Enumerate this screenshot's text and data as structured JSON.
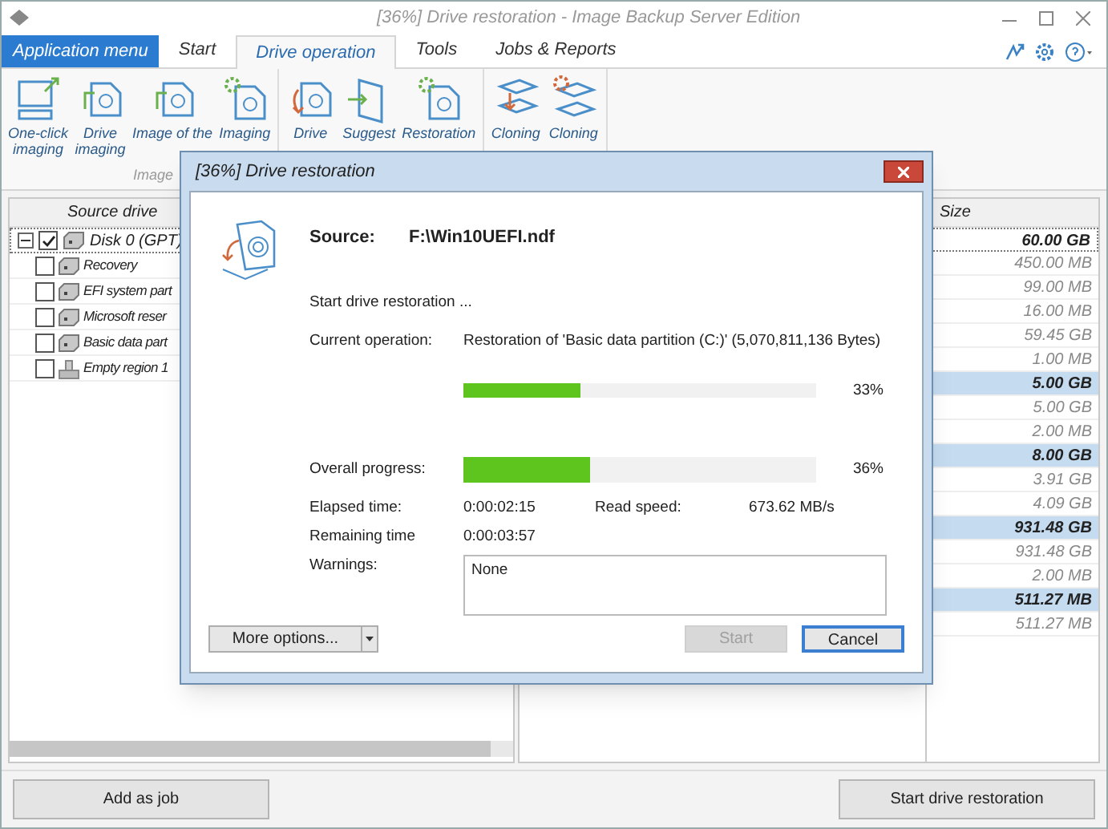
{
  "window": {
    "title": "[36%] Drive restoration - Image Backup Server Edition"
  },
  "app_menu": "Application menu",
  "tabs": [
    {
      "label": "Start",
      "selected": false
    },
    {
      "label": "Drive operation",
      "selected": true
    },
    {
      "label": "Tools",
      "selected": false
    },
    {
      "label": "Jobs & Reports",
      "selected": false
    }
  ],
  "ribbon": {
    "groups": [
      {
        "label": "Image",
        "items": [
          {
            "lines": [
              "One-click",
              "imaging"
            ],
            "kind": "monitor"
          },
          {
            "lines": [
              "Drive",
              "imaging"
            ],
            "kind": "disk"
          },
          {
            "lines": [
              "Image of the"
            ],
            "kind": "disk"
          },
          {
            "lines": [
              "Imaging"
            ],
            "kind": "gear"
          }
        ]
      },
      {
        "items": [
          {
            "lines": [
              "Drive"
            ],
            "kind": "restore"
          },
          {
            "lines": [
              "Suggest"
            ],
            "kind": "door"
          },
          {
            "lines": [
              "Restoration"
            ],
            "kind": "gear"
          }
        ]
      },
      {
        "items": [
          {
            "lines": [
              "Cloning"
            ],
            "kind": "clone"
          },
          {
            "lines": [
              "Cloning"
            ],
            "kind": "clonegear"
          }
        ]
      }
    ]
  },
  "source_tree": {
    "column": "Source drive",
    "disk": {
      "name": "Disk 0 (GPT)",
      "checked": true,
      "expanded": true,
      "children": [
        {
          "name": "Recovery",
          "checked": false,
          "kind": "partition"
        },
        {
          "name": "EFI system part",
          "checked": false,
          "kind": "partition"
        },
        {
          "name": "Microsoft reser",
          "checked": false,
          "kind": "partition"
        },
        {
          "name": "Basic data part",
          "checked": false,
          "kind": "partition"
        },
        {
          "name": "Empty region 1",
          "checked": false,
          "kind": "empty"
        }
      ]
    }
  },
  "size_table": {
    "column": "Size",
    "rows": [
      {
        "value": "60.00 GB",
        "kind": "disk",
        "focused": true
      },
      {
        "value": "450.00 MB",
        "kind": "partition",
        "focused": false
      },
      {
        "value": "99.00 MB",
        "kind": "partition",
        "focused": false
      },
      {
        "value": "16.00 MB",
        "kind": "partition",
        "focused": false
      },
      {
        "value": "59.45 GB",
        "kind": "partition",
        "focused": false
      },
      {
        "value": "1.00 MB",
        "kind": "partition",
        "focused": false
      },
      {
        "value": "5.00 GB",
        "kind": "disk",
        "focused": false
      },
      {
        "value": "5.00 GB",
        "kind": "partition",
        "focused": false
      },
      {
        "value": "2.00 MB",
        "kind": "partition",
        "focused": false
      },
      {
        "value": "8.00 GB",
        "kind": "disk",
        "focused": false
      },
      {
        "value": "3.91 GB",
        "kind": "partition",
        "focused": false
      },
      {
        "value": "4.09 GB",
        "kind": "partition",
        "focused": false
      },
      {
        "value": "931.48 GB",
        "kind": "disk",
        "focused": false
      },
      {
        "value": "931.48 GB",
        "kind": "partition",
        "focused": false
      },
      {
        "value": "2.00 MB",
        "kind": "partition",
        "focused": false
      },
      {
        "value": "511.27 MB",
        "kind": "disk",
        "focused": false
      },
      {
        "value": "511.27 MB",
        "kind": "partition",
        "focused": false
      }
    ]
  },
  "bottom_buttons": [
    "Add as job",
    "Start drive restoration"
  ],
  "dialog": {
    "title": "[36%] Drive restoration",
    "source_label": "Source:",
    "source_value": "F:\\Win10UEFI.ndf",
    "status": "Start drive restoration ...",
    "current_label": "Current operation:",
    "current_value": "Restoration of 'Basic data partition (C:)' (5,070,811,136 Bytes)",
    "current_progress": {
      "level": 0.33,
      "reading": "33%"
    },
    "overall_label": "Overall progress:",
    "overall_progress": {
      "level": 0.36,
      "reading": "36%"
    },
    "elapsed_label": "Elapsed time:",
    "elapsed_value": "0:00:02:15",
    "speed_label": "Read speed:",
    "speed_value": "673.62 MB/s",
    "remaining_label": "Remaining time",
    "remaining_value": "0:00:03:57",
    "warnings_label": "Warnings:",
    "warnings_value": "None",
    "buttons": [
      {
        "label": "More options...",
        "kind": "split",
        "disabled": false
      },
      {
        "label": "Start",
        "kind": "plain",
        "disabled": true
      },
      {
        "label": "Cancel",
        "kind": "default",
        "disabled": false
      }
    ]
  }
}
